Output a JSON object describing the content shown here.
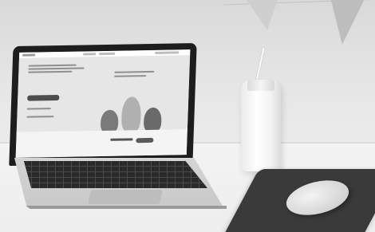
{
  "scene": {
    "objects": [
      "laptop",
      "milk-bottle",
      "mouse",
      "mousepad",
      "bunting-flags"
    ]
  },
  "laptop_screen": {
    "header_logo": "",
    "hero_title": "",
    "hero_button": "",
    "footer_cta_text": "",
    "footer_cta_button": ""
  },
  "colors": {
    "wall": "#dedede",
    "desk": "#f0f0f0",
    "mousepad": "#3a3a3a"
  }
}
